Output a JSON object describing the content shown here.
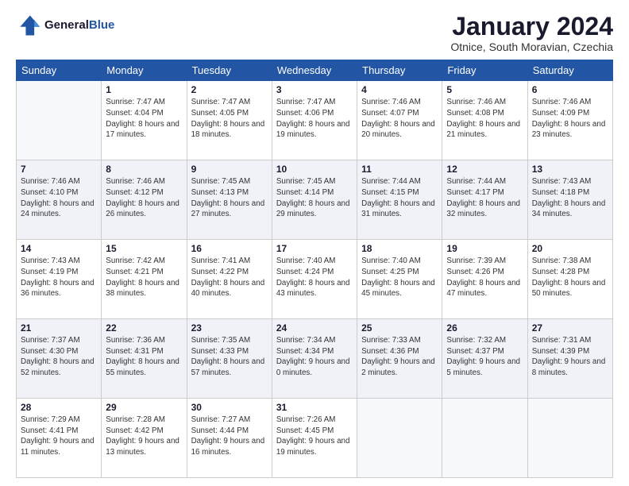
{
  "header": {
    "logo_line1": "General",
    "logo_line2": "Blue",
    "month_title": "January 2024",
    "location": "Otnice, South Moravian, Czechia"
  },
  "days_of_week": [
    "Sunday",
    "Monday",
    "Tuesday",
    "Wednesday",
    "Thursday",
    "Friday",
    "Saturday"
  ],
  "weeks": [
    [
      {
        "day": "",
        "sunrise": "",
        "sunset": "",
        "daylight": ""
      },
      {
        "day": "1",
        "sunrise": "Sunrise: 7:47 AM",
        "sunset": "Sunset: 4:04 PM",
        "daylight": "Daylight: 8 hours and 17 minutes."
      },
      {
        "day": "2",
        "sunrise": "Sunrise: 7:47 AM",
        "sunset": "Sunset: 4:05 PM",
        "daylight": "Daylight: 8 hours and 18 minutes."
      },
      {
        "day": "3",
        "sunrise": "Sunrise: 7:47 AM",
        "sunset": "Sunset: 4:06 PM",
        "daylight": "Daylight: 8 hours and 19 minutes."
      },
      {
        "day": "4",
        "sunrise": "Sunrise: 7:46 AM",
        "sunset": "Sunset: 4:07 PM",
        "daylight": "Daylight: 8 hours and 20 minutes."
      },
      {
        "day": "5",
        "sunrise": "Sunrise: 7:46 AM",
        "sunset": "Sunset: 4:08 PM",
        "daylight": "Daylight: 8 hours and 21 minutes."
      },
      {
        "day": "6",
        "sunrise": "Sunrise: 7:46 AM",
        "sunset": "Sunset: 4:09 PM",
        "daylight": "Daylight: 8 hours and 23 minutes."
      }
    ],
    [
      {
        "day": "7",
        "sunrise": "Sunrise: 7:46 AM",
        "sunset": "Sunset: 4:10 PM",
        "daylight": "Daylight: 8 hours and 24 minutes."
      },
      {
        "day": "8",
        "sunrise": "Sunrise: 7:46 AM",
        "sunset": "Sunset: 4:12 PM",
        "daylight": "Daylight: 8 hours and 26 minutes."
      },
      {
        "day": "9",
        "sunrise": "Sunrise: 7:45 AM",
        "sunset": "Sunset: 4:13 PM",
        "daylight": "Daylight: 8 hours and 27 minutes."
      },
      {
        "day": "10",
        "sunrise": "Sunrise: 7:45 AM",
        "sunset": "Sunset: 4:14 PM",
        "daylight": "Daylight: 8 hours and 29 minutes."
      },
      {
        "day": "11",
        "sunrise": "Sunrise: 7:44 AM",
        "sunset": "Sunset: 4:15 PM",
        "daylight": "Daylight: 8 hours and 31 minutes."
      },
      {
        "day": "12",
        "sunrise": "Sunrise: 7:44 AM",
        "sunset": "Sunset: 4:17 PM",
        "daylight": "Daylight: 8 hours and 32 minutes."
      },
      {
        "day": "13",
        "sunrise": "Sunrise: 7:43 AM",
        "sunset": "Sunset: 4:18 PM",
        "daylight": "Daylight: 8 hours and 34 minutes."
      }
    ],
    [
      {
        "day": "14",
        "sunrise": "Sunrise: 7:43 AM",
        "sunset": "Sunset: 4:19 PM",
        "daylight": "Daylight: 8 hours and 36 minutes."
      },
      {
        "day": "15",
        "sunrise": "Sunrise: 7:42 AM",
        "sunset": "Sunset: 4:21 PM",
        "daylight": "Daylight: 8 hours and 38 minutes."
      },
      {
        "day": "16",
        "sunrise": "Sunrise: 7:41 AM",
        "sunset": "Sunset: 4:22 PM",
        "daylight": "Daylight: 8 hours and 40 minutes."
      },
      {
        "day": "17",
        "sunrise": "Sunrise: 7:40 AM",
        "sunset": "Sunset: 4:24 PM",
        "daylight": "Daylight: 8 hours and 43 minutes."
      },
      {
        "day": "18",
        "sunrise": "Sunrise: 7:40 AM",
        "sunset": "Sunset: 4:25 PM",
        "daylight": "Daylight: 8 hours and 45 minutes."
      },
      {
        "day": "19",
        "sunrise": "Sunrise: 7:39 AM",
        "sunset": "Sunset: 4:26 PM",
        "daylight": "Daylight: 8 hours and 47 minutes."
      },
      {
        "day": "20",
        "sunrise": "Sunrise: 7:38 AM",
        "sunset": "Sunset: 4:28 PM",
        "daylight": "Daylight: 8 hours and 50 minutes."
      }
    ],
    [
      {
        "day": "21",
        "sunrise": "Sunrise: 7:37 AM",
        "sunset": "Sunset: 4:30 PM",
        "daylight": "Daylight: 8 hours and 52 minutes."
      },
      {
        "day": "22",
        "sunrise": "Sunrise: 7:36 AM",
        "sunset": "Sunset: 4:31 PM",
        "daylight": "Daylight: 8 hours and 55 minutes."
      },
      {
        "day": "23",
        "sunrise": "Sunrise: 7:35 AM",
        "sunset": "Sunset: 4:33 PM",
        "daylight": "Daylight: 8 hours and 57 minutes."
      },
      {
        "day": "24",
        "sunrise": "Sunrise: 7:34 AM",
        "sunset": "Sunset: 4:34 PM",
        "daylight": "Daylight: 9 hours and 0 minutes."
      },
      {
        "day": "25",
        "sunrise": "Sunrise: 7:33 AM",
        "sunset": "Sunset: 4:36 PM",
        "daylight": "Daylight: 9 hours and 2 minutes."
      },
      {
        "day": "26",
        "sunrise": "Sunrise: 7:32 AM",
        "sunset": "Sunset: 4:37 PM",
        "daylight": "Daylight: 9 hours and 5 minutes."
      },
      {
        "day": "27",
        "sunrise": "Sunrise: 7:31 AM",
        "sunset": "Sunset: 4:39 PM",
        "daylight": "Daylight: 9 hours and 8 minutes."
      }
    ],
    [
      {
        "day": "28",
        "sunrise": "Sunrise: 7:29 AM",
        "sunset": "Sunset: 4:41 PM",
        "daylight": "Daylight: 9 hours and 11 minutes."
      },
      {
        "day": "29",
        "sunrise": "Sunrise: 7:28 AM",
        "sunset": "Sunset: 4:42 PM",
        "daylight": "Daylight: 9 hours and 13 minutes."
      },
      {
        "day": "30",
        "sunrise": "Sunrise: 7:27 AM",
        "sunset": "Sunset: 4:44 PM",
        "daylight": "Daylight: 9 hours and 16 minutes."
      },
      {
        "day": "31",
        "sunrise": "Sunrise: 7:26 AM",
        "sunset": "Sunset: 4:45 PM",
        "daylight": "Daylight: 9 hours and 19 minutes."
      },
      {
        "day": "",
        "sunrise": "",
        "sunset": "",
        "daylight": ""
      },
      {
        "day": "",
        "sunrise": "",
        "sunset": "",
        "daylight": ""
      },
      {
        "day": "",
        "sunrise": "",
        "sunset": "",
        "daylight": ""
      }
    ]
  ]
}
